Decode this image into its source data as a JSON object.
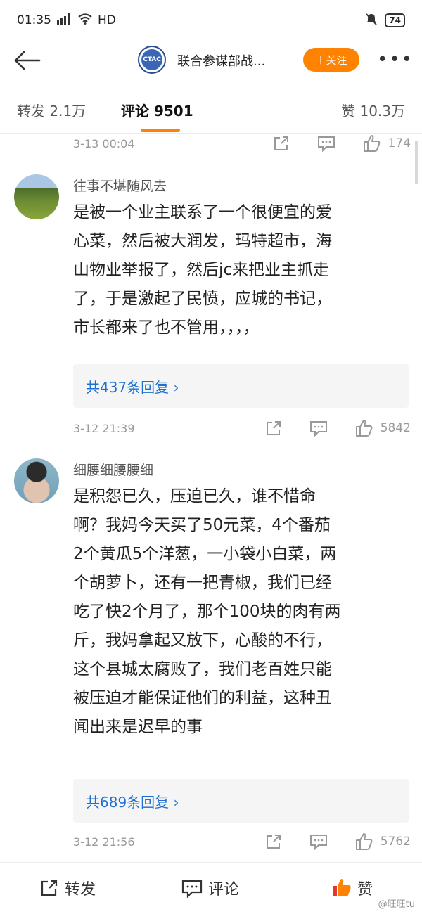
{
  "status_bar": {
    "time": "01:35",
    "signal": "HD",
    "battery": "74"
  },
  "nav": {
    "account_logo_text": "CTAC",
    "account_name": "联合参谋部战...",
    "follow_label": "＋关注",
    "more_label": "•••"
  },
  "tabs": {
    "repost": "转发 2.1万",
    "comment": "评论 9501",
    "like": "赞 10.3万"
  },
  "comments": [
    {
      "time": "3-13 00:04",
      "likes": "174"
    },
    {
      "username": "往事不堪随风去",
      "content_lines": [
        "是被一个业主联系了一个很便宜的爱",
        "心菜，然后被大润发，玛特超市，海",
        "山物业举报了，然后jc来把业主抓走",
        "了，于是激起了民愤，应城的书记，",
        "市长都来了也不管用，，，，"
      ],
      "replies": "共437条回复 ›",
      "time": "3-12 21:39",
      "likes": "5842"
    },
    {
      "username": "细腰细腰腰细",
      "content_lines": [
        "是积怨已久，压迫已久，谁不惜命",
        "啊？我妈今天买了50元菜，4个番茄",
        "2个黄瓜5个洋葱，一小袋小白菜，两",
        "个胡萝卜，还有一把青椒，我们已经",
        "吃了快2个月了，那个100块的肉有两",
        "斤，我妈拿起又放下，心酸的不行，",
        "这个县城太腐败了，我们老百姓只能",
        "被压迫才能保证他们的利益，这种丑",
        "闻出来是迟早的事"
      ],
      "replies": "共689条回复 ›",
      "time": "3-12 21:56",
      "likes": "5762"
    }
  ],
  "bottom_bar": {
    "repost": "转发",
    "comment": "评论",
    "like": "赞",
    "watermark": "@旺旺tu"
  },
  "colors": {
    "accent": "#ff8200",
    "link": "#1e6fd0",
    "meta": "#999999"
  }
}
